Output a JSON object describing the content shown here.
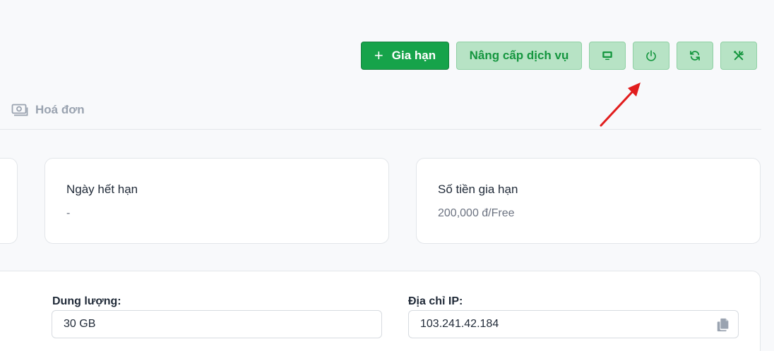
{
  "toolbar": {
    "renew_label": "Gia hạn",
    "renew_icon": "plus-icon",
    "upgrade_label": "Nâng cấp dịch vụ",
    "icons": [
      "monitor-icon",
      "power-icon",
      "refresh-icon",
      "tools-icon"
    ]
  },
  "tabs": {
    "invoice_label": "Hoá đơn",
    "invoice_icon": "money-icon"
  },
  "cards": {
    "expiry": {
      "title": "Ngày hết hạn",
      "value": "-"
    },
    "renew_amount": {
      "title": "Số tiền gia hạn",
      "value": "200,000 đ/Free"
    }
  },
  "fields": {
    "storage": {
      "label": "Dung lượng:",
      "value": "30 GB"
    },
    "ip": {
      "label": "Địa chỉ IP:",
      "value": "103.241.42.184"
    }
  },
  "colors": {
    "primary": "#16a34a",
    "soft_bg": "#b7e3c5",
    "soft_text": "#15963f",
    "annotation": "#e11d1d"
  }
}
